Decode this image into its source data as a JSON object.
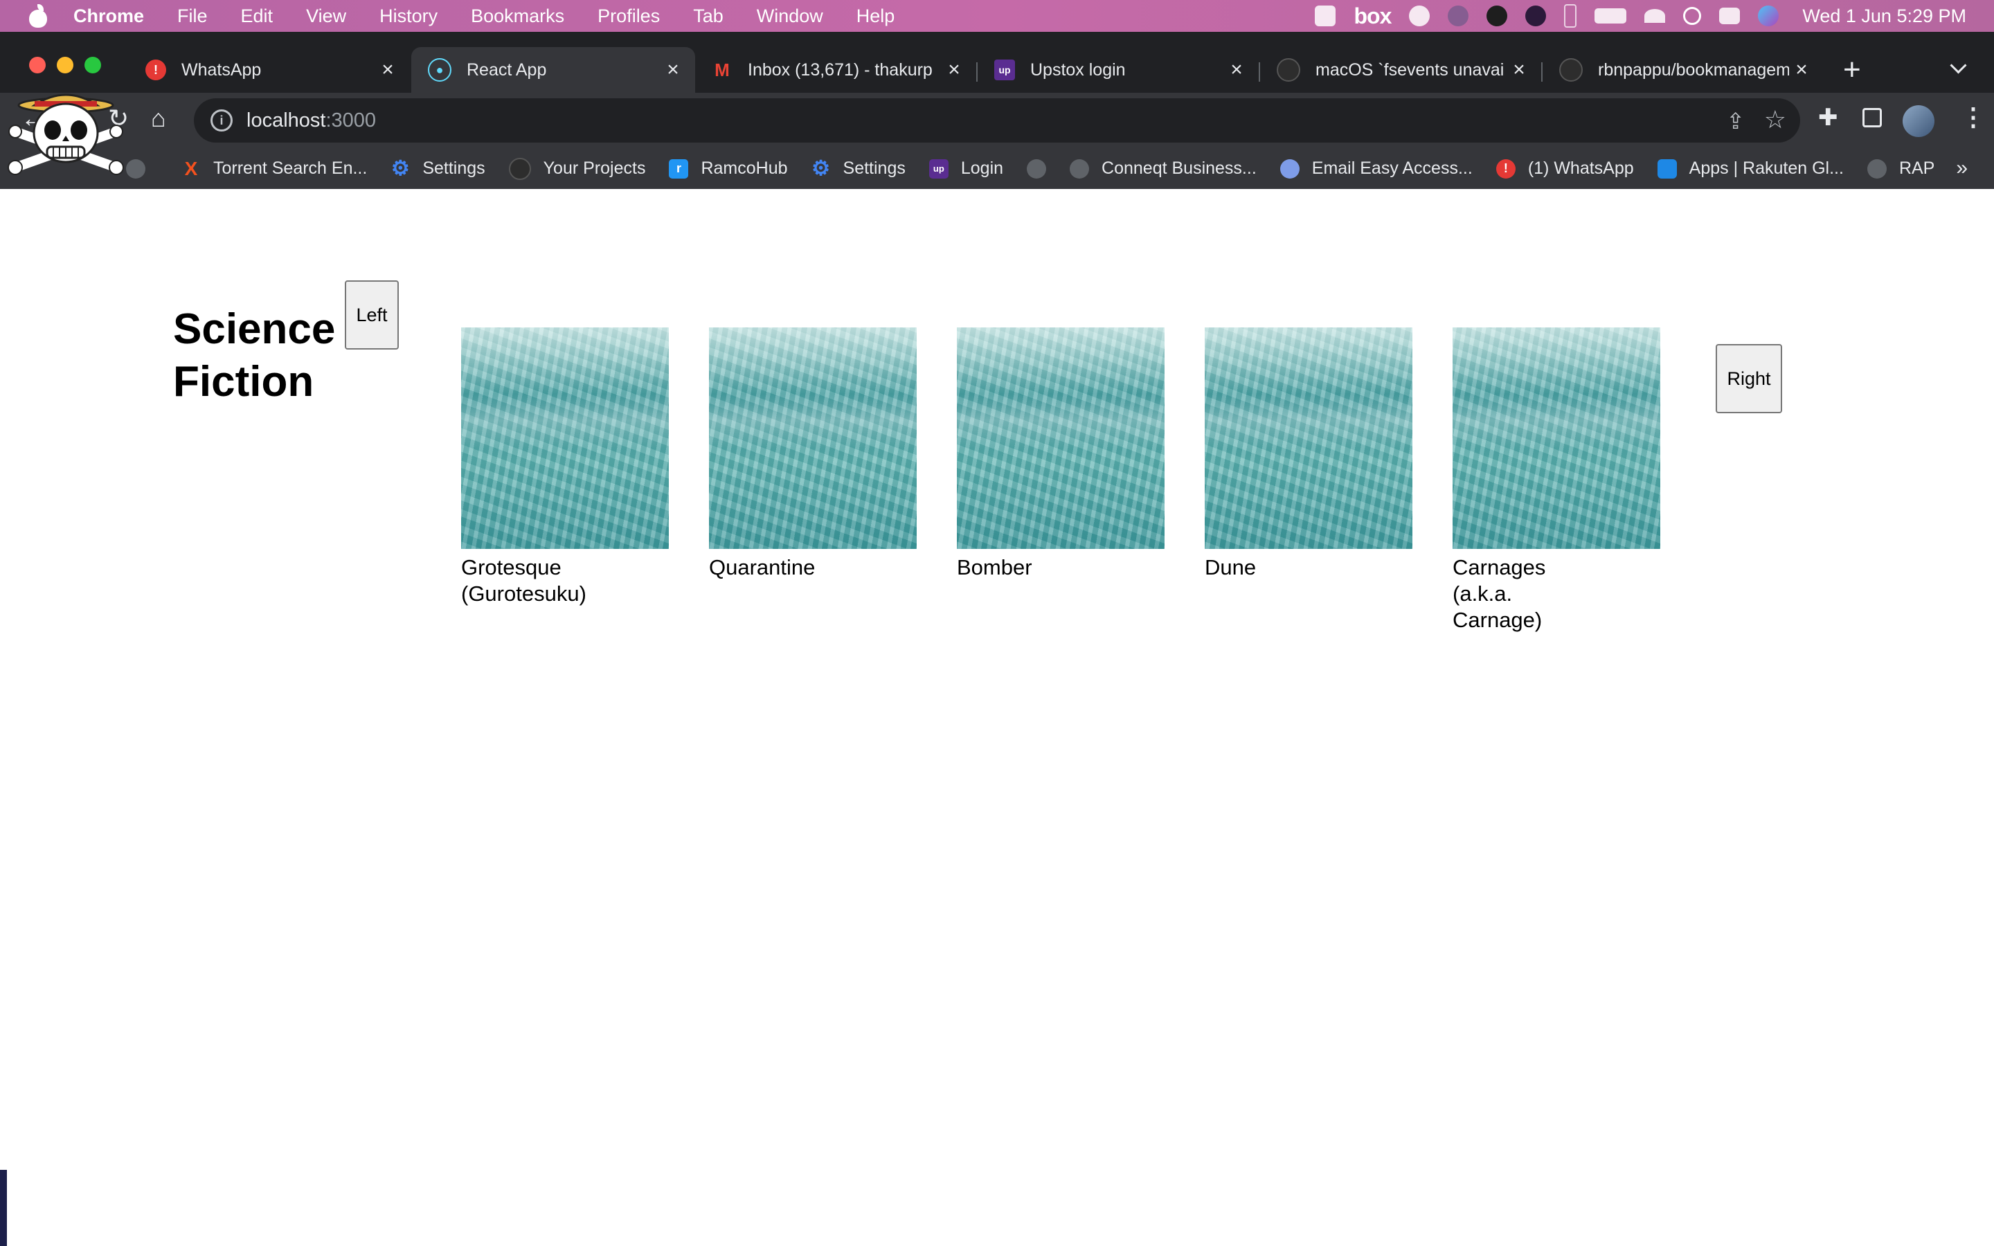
{
  "menubar": {
    "app_name": "Chrome",
    "menus": [
      "File",
      "Edit",
      "View",
      "History",
      "Bookmarks",
      "Profiles",
      "Tab",
      "Window",
      "Help"
    ],
    "box_label": "box",
    "clock": "Wed 1 Jun  5:29 PM"
  },
  "tabs": [
    {
      "title": "WhatsApp",
      "icon": "whatsapp-alert-icon",
      "active": false
    },
    {
      "title": "React App",
      "icon": "react-icon",
      "active": true
    },
    {
      "title": "Inbox (13,671) - thakurp",
      "icon": "gmail-icon",
      "active": false
    },
    {
      "title": "Upstox login",
      "icon": "upstox-icon",
      "active": false
    },
    {
      "title": "macOS `fsevents unavai",
      "icon": "github-icon",
      "active": false
    },
    {
      "title": "rbnpappu/bookmanagem",
      "icon": "github-icon",
      "active": false
    }
  ],
  "address_bar": {
    "host": "localhost",
    "port": ":3000"
  },
  "bookmarks": [
    {
      "label": "",
      "icon": "globe-icon"
    },
    {
      "label": "Torrent Search En...",
      "icon": "torrent-icon"
    },
    {
      "label": "Settings",
      "icon": "gear-icon"
    },
    {
      "label": "Your Projects",
      "icon": "github-icon"
    },
    {
      "label": "RamcoHub",
      "icon": "ramcohub-icon"
    },
    {
      "label": "Settings",
      "icon": "gear-icon"
    },
    {
      "label": "Login",
      "icon": "upstox-icon"
    },
    {
      "label": "",
      "icon": "globe-icon"
    },
    {
      "label": "Conneqt Business...",
      "icon": "globe-icon"
    },
    {
      "label": "Email Easy Access...",
      "icon": "email-icon"
    },
    {
      "label": "(1) WhatsApp",
      "icon": "whatsapp-alert-icon"
    },
    {
      "label": "Apps | Rakuten Gl...",
      "icon": "rakuten-icon"
    },
    {
      "label": "RAP",
      "icon": "globe-icon"
    }
  ],
  "bookmarks_overflow": "»",
  "page": {
    "genre_title": "Science Fiction",
    "left_button": "Left",
    "right_button": "Right",
    "books": [
      {
        "title": "Grotesque (Gurotesuku)"
      },
      {
        "title": "Quarantine"
      },
      {
        "title": "Bomber"
      },
      {
        "title": "Dune"
      },
      {
        "title": "Carnages (a.k.a. Carnage)"
      }
    ]
  },
  "colors": {
    "menubar": "#c06aa6",
    "tabstrip": "#202124",
    "toolbar": "#35363a",
    "page_bg": "#ffffff"
  }
}
